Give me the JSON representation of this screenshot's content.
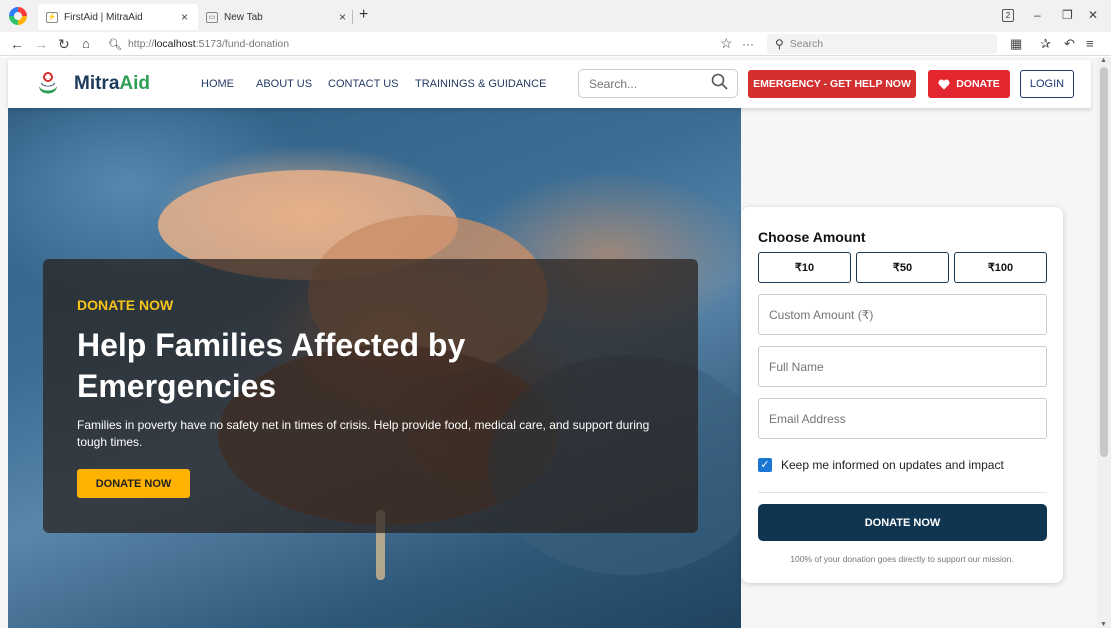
{
  "browser": {
    "tabs": [
      {
        "label": "FirstAid | MitraAid",
        "active": true
      },
      {
        "label": "New Tab",
        "active": false
      }
    ],
    "tab_count": "2",
    "url_prefix": "http://",
    "url_host": "localhost",
    "url_path": ":5173/fund-donation",
    "search_placeholder": "Search"
  },
  "site": {
    "brand_part1": "Mitra",
    "brand_part2": "Aid",
    "nav": [
      "HOME",
      "ABOUT US",
      "CONTACT US",
      "TRAININGS & GUIDANCE"
    ],
    "search_placeholder": "Search...",
    "emergency_label": "EMERGENCY - GET HELP NOW",
    "donate_label": "DONATE",
    "login_label": "LOGIN"
  },
  "hero": {
    "eyebrow": "DONATE NOW",
    "title": "Help Families Affected by Emergencies",
    "text": "Families in poverty have no safety net in times of crisis. Help provide food, medical care, and support during tough times.",
    "button": "DONATE NOW"
  },
  "donation": {
    "title": "Choose Amount",
    "amounts": [
      "₹10",
      "₹50",
      "₹100"
    ],
    "custom_placeholder": "Custom Amount (₹)",
    "name_placeholder": "Full Name",
    "email_placeholder": "Email Address",
    "keep_informed": "Keep me informed on updates and impact",
    "keep_informed_checked": true,
    "submit": "DONATE NOW",
    "footnote": "100% of your donation goes directly to support our mission."
  },
  "colors": {
    "brand_dark": "#1c3a5c",
    "brand_green": "#2e9e54",
    "emergency_red": "#d32f2f",
    "accent_yellow": "#ffb300",
    "submit_navy": "#0f3550"
  }
}
